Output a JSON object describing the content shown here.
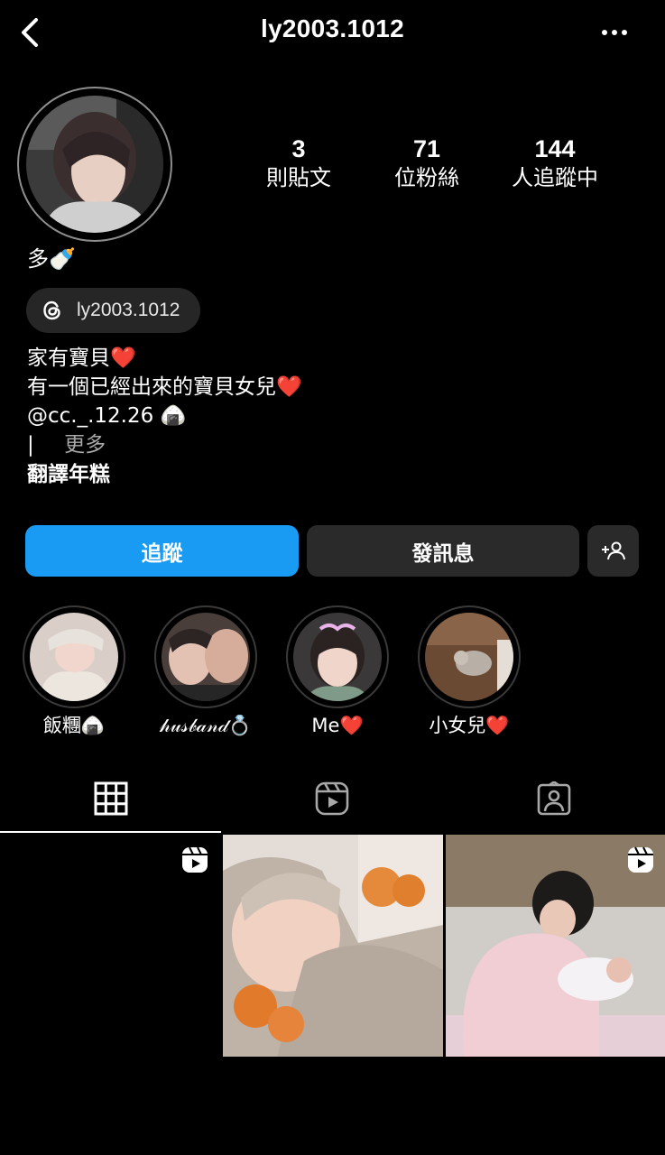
{
  "header": {
    "username": "ly2003.1012",
    "back_icon": "chevron-left-icon",
    "more_icon": "more-horizontal-icon"
  },
  "profile": {
    "display_name": "多🍼",
    "stats": [
      {
        "value": "3",
        "label": "則貼文"
      },
      {
        "value": "71",
        "label": "位粉絲"
      },
      {
        "value": "144",
        "label": "人追蹤中"
      }
    ],
    "threads_handle": "ly2003.1012",
    "bio_lines": [
      "家有寶貝❤️",
      "有一個已經出來的寶貝女兒❤️",
      "@cc._.12.26 🍙"
    ],
    "bio_cursor": "|",
    "bio_more": "更多",
    "translate": "翻譯年糕"
  },
  "actions": {
    "follow": "追蹤",
    "message": "發訊息",
    "add_icon": "add-person-icon"
  },
  "highlights": [
    {
      "label": "飯糰🍙"
    },
    {
      "label": "𝒽𝓊𝓈𝒷𝒶𝓃𝒹💍"
    },
    {
      "label": "Me❤️"
    },
    {
      "label": "小女兒❤️"
    }
  ],
  "tabs": [
    {
      "icon": "grid-icon",
      "active": true
    },
    {
      "icon": "reels-icon",
      "active": false
    },
    {
      "icon": "tagged-icon",
      "active": false
    }
  ],
  "colors": {
    "background": "#000000",
    "follow_button": "#1a9bf3",
    "secondary_button": "#2a2a2a",
    "muted_text": "#a8a8a8"
  }
}
